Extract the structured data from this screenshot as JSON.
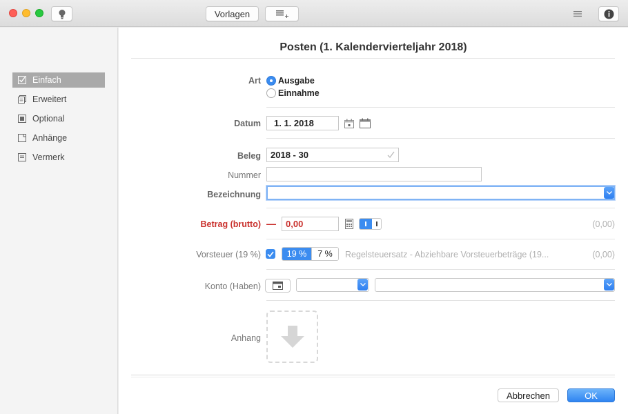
{
  "toolbar": {
    "templates_label": "Vorlagen"
  },
  "sidebar": {
    "items": [
      {
        "label": "Einfach"
      },
      {
        "label": "Erweitert"
      },
      {
        "label": "Optional"
      },
      {
        "label": "Anhänge"
      },
      {
        "label": "Vermerk"
      }
    ]
  },
  "form": {
    "title": "Posten (1. Kalendervierteljahr 2018)",
    "art": {
      "label": "Art",
      "options": [
        "Ausgabe",
        "Einnahme"
      ],
      "selected": "Ausgabe"
    },
    "datum": {
      "label": "Datum",
      "value": "1.  1. 2018"
    },
    "beleg": {
      "label": "Beleg",
      "value": "2018 - 30"
    },
    "nummer": {
      "label": "Nummer",
      "value": ""
    },
    "bezeichnung": {
      "label": "Bezeichnung",
      "value": ""
    },
    "betrag": {
      "label": "Betrag (brutto)",
      "sign": "—",
      "value": "0,00",
      "summary": "(0,00)"
    },
    "vorsteuer": {
      "label": "Vorsteuer (19 %)",
      "checked": true,
      "rates": [
        "19 %",
        "7 %"
      ],
      "selected_rate": "19 %",
      "description": "Regelsteuersatz - Abziehbare Vorsteuerbeträge (19...",
      "summary": "(0,00)"
    },
    "konto": {
      "label": "Konto (Haben)"
    },
    "anhang": {
      "label": "Anhang"
    }
  },
  "footer": {
    "cancel_label": "Abbrechen",
    "ok_label": "OK"
  },
  "colors": {
    "accent": "#3b8cf0",
    "error": "#c9302c",
    "sidebar_active": "#a9a9a9"
  }
}
